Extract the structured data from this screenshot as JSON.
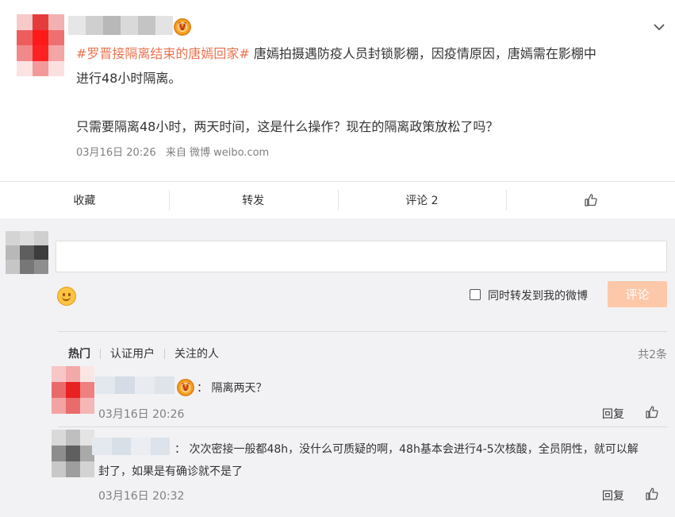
{
  "post": {
    "hashtag": "#罗晋接隔离结束的唐嫣回家#",
    "text_line1": " 唐嫣拍摄遇防疫人员封锁影棚，因疫情原因，唐嫣需在影棚中",
    "text_line2": "进行48小时隔离。",
    "text_line3": "只需要隔离48小时，两天时间，这是什么操作？现在的隔离政策放松了吗？",
    "time": "03月16日 20:26",
    "source": "来自 微博 weibo.com",
    "verified_badge": "V"
  },
  "actions": {
    "favorite": "收藏",
    "repost": "转发",
    "comment": "评论 2",
    "like_icon": "thumbs-up-icon"
  },
  "composer": {
    "input_value": "",
    "repost_label": "同时转发到我的微博",
    "submit_label": "评论",
    "emoji_icon": "smiley-icon"
  },
  "filter": {
    "tabs": [
      "热门",
      "认证用户",
      "关注的人"
    ],
    "count": "共2条"
  },
  "comments": [
    {
      "text": "： 隔离两天？",
      "time": "03月16日 20:26",
      "reply": "回复",
      "verified_badge": "V"
    },
    {
      "text_line1": "： 次次密接一般都48h，没什么可质疑的啊，48h基本会进行4-5次核酸，全员阴性，就可以解",
      "text_line2": "封了，如果是有确诊就不是了",
      "time": "03月16日 20:32",
      "reply": "回复"
    }
  ],
  "colors": {
    "accent": "#eb7350",
    "submit_disabled": "#fdc8a9",
    "muted": "#808080"
  }
}
